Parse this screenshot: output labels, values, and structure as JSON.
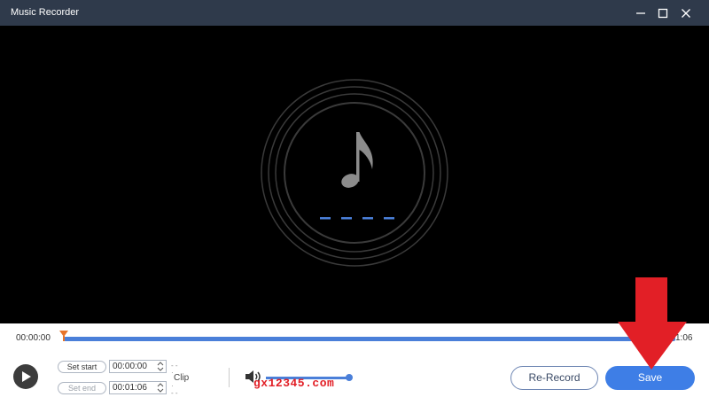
{
  "window": {
    "title": "Music Recorder",
    "controls": [
      "minimize-icon",
      "maximize-icon",
      "close-icon"
    ]
  },
  "stage": {
    "icon": "music-note-icon",
    "background": "#000000"
  },
  "timeline": {
    "current_time": "00:00:00",
    "end_time": "00:01:06",
    "end_time_visible": "1:06"
  },
  "clip": {
    "set_start_label": "Set start",
    "set_end_label": "Set end",
    "start_value": "00:00:00",
    "end_value": "00:01:06",
    "clip_label": "Clip"
  },
  "volume": {
    "icon": "speaker-icon",
    "level": 1.0
  },
  "watermark": "gx12345.com",
  "buttons": {
    "rerecord_label": "Re-Record",
    "save_label": "Save"
  },
  "colors": {
    "accent": "#3e7ee6",
    "titlebar": "#2f3a4b",
    "arrow": "#e21f26"
  }
}
